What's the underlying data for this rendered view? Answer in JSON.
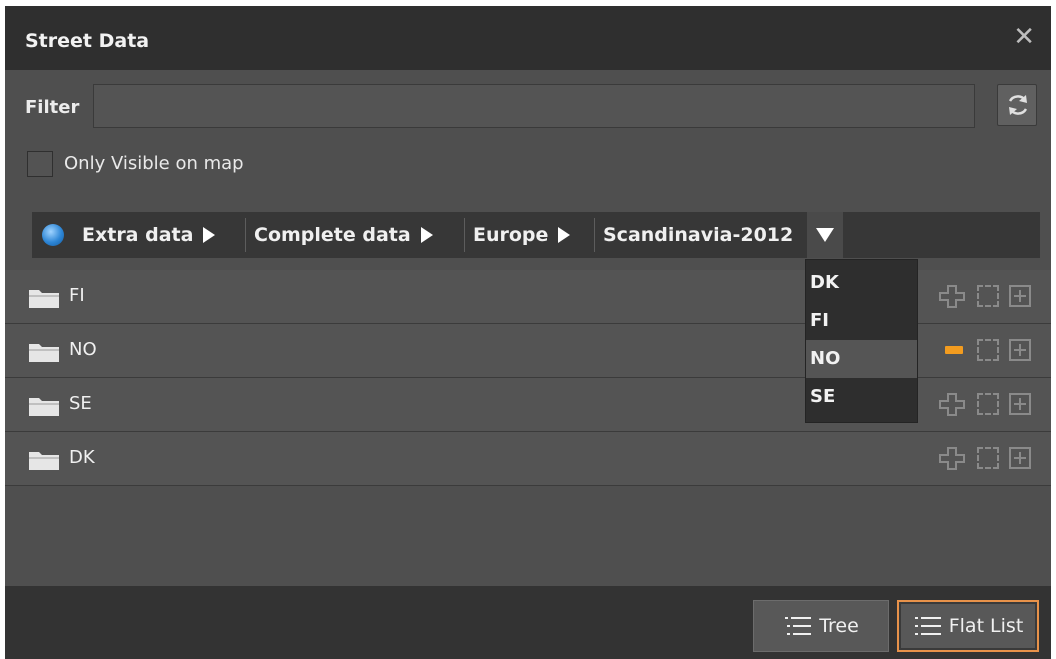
{
  "window": {
    "title": "Street Data",
    "close_glyph": "✕"
  },
  "filter": {
    "label": "Filter",
    "value": "",
    "placeholder": ""
  },
  "only_visible": {
    "label": "Only Visible on map",
    "checked": false
  },
  "breadcrumb": {
    "icon": "globe-icon",
    "items": [
      {
        "label": "Extra data"
      },
      {
        "label": "Complete data"
      },
      {
        "label": "Europe"
      },
      {
        "label": "Scandinavia-2012"
      }
    ]
  },
  "rows": [
    {
      "name": "FI",
      "action": "plus"
    },
    {
      "name": "NO",
      "action": "minus"
    },
    {
      "name": "SE",
      "action": "plus"
    },
    {
      "name": "DK",
      "action": "plus"
    }
  ],
  "dropdown": {
    "options": [
      "DK",
      "FI",
      "NO",
      "SE"
    ],
    "highlighted": "NO"
  },
  "footer": {
    "tree_label": "Tree",
    "flat_list_label": "Flat List",
    "active_view": "Flat List"
  },
  "colors": {
    "accent": "#e8924a",
    "minus_indicator": "#f39c1f"
  }
}
